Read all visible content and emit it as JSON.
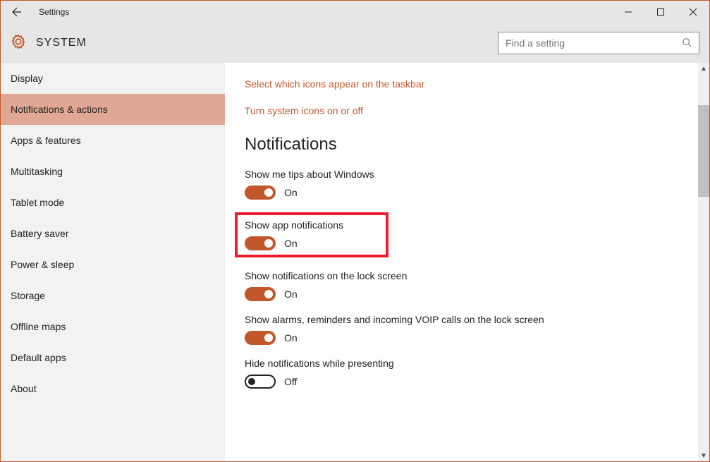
{
  "window": {
    "title": "Settings"
  },
  "header": {
    "section": "SYSTEM",
    "search_placeholder": "Find a setting"
  },
  "sidebar": {
    "items": [
      {
        "label": "Display",
        "selected": false
      },
      {
        "label": "Notifications & actions",
        "selected": true
      },
      {
        "label": "Apps & features",
        "selected": false
      },
      {
        "label": "Multitasking",
        "selected": false
      },
      {
        "label": "Tablet mode",
        "selected": false
      },
      {
        "label": "Battery saver",
        "selected": false
      },
      {
        "label": "Power & sleep",
        "selected": false
      },
      {
        "label": "Storage",
        "selected": false
      },
      {
        "label": "Offline maps",
        "selected": false
      },
      {
        "label": "Default apps",
        "selected": false
      },
      {
        "label": "About",
        "selected": false
      }
    ]
  },
  "content": {
    "link1": "Select which icons appear on the taskbar",
    "link2": "Turn system icons on or off",
    "heading": "Notifications",
    "settings": [
      {
        "label": "Show me tips about Windows",
        "state": "On",
        "on": true,
        "highlighted": false
      },
      {
        "label": "Show app notifications",
        "state": "On",
        "on": true,
        "highlighted": true
      },
      {
        "label": "Show notifications on the lock screen",
        "state": "On",
        "on": true,
        "highlighted": false
      },
      {
        "label": "Show alarms, reminders and incoming VOIP calls on the lock screen",
        "state": "On",
        "on": true,
        "highlighted": false
      },
      {
        "label": "Hide notifications while presenting",
        "state": "Off",
        "on": false,
        "highlighted": false
      }
    ]
  }
}
